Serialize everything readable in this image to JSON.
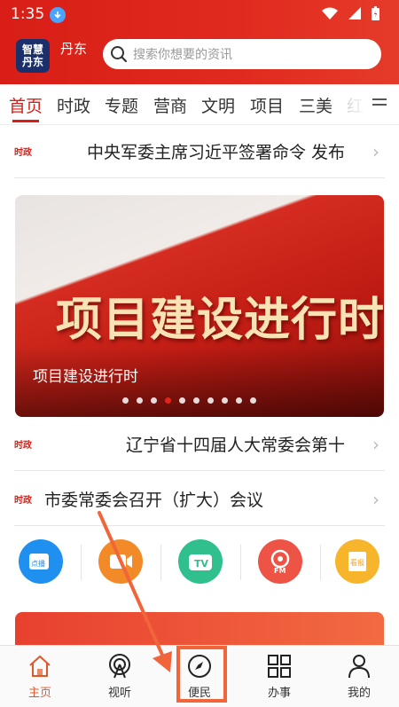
{
  "status_bar": {
    "time": "1:35"
  },
  "header": {
    "logo_line1": "智慧",
    "logo_line2": "丹东",
    "city": "丹东",
    "search_placeholder": "搜索你想要的资讯"
  },
  "tabs": [
    {
      "label": "首页"
    },
    {
      "label": "时政"
    },
    {
      "label": "专题"
    },
    {
      "label": "营商"
    },
    {
      "label": "文明"
    },
    {
      "label": "项目"
    },
    {
      "label": "三美"
    },
    {
      "label": "红"
    }
  ],
  "news": [
    {
      "tag": "时政",
      "title": "中央军委主席习近平签署命令  发布"
    },
    {
      "tag": "时政",
      "title": "辽宁省十四届人大常委会第十"
    },
    {
      "tag": "时政",
      "title": "市委常委会召开（扩大）会议"
    }
  ],
  "banner": {
    "title": "项目建设进行时",
    "caption": "项目建设进行时",
    "dot_count": 10,
    "active_dot": 3
  },
  "shortcuts": [
    {
      "name": "live-icon",
      "label": "点播"
    },
    {
      "name": "video-icon",
      "label": ""
    },
    {
      "name": "tv-icon",
      "label": "TV"
    },
    {
      "name": "radio-fm-icon",
      "label": "FM"
    },
    {
      "name": "newspaper-icon",
      "label": "看报"
    }
  ],
  "bottom_nav": [
    {
      "label": "主页"
    },
    {
      "label": "视听"
    },
    {
      "label": "便民"
    },
    {
      "label": "办事"
    },
    {
      "label": "我的"
    }
  ],
  "colors": {
    "brand_red": "#d81e16",
    "accent_orange": "#f0653a"
  }
}
